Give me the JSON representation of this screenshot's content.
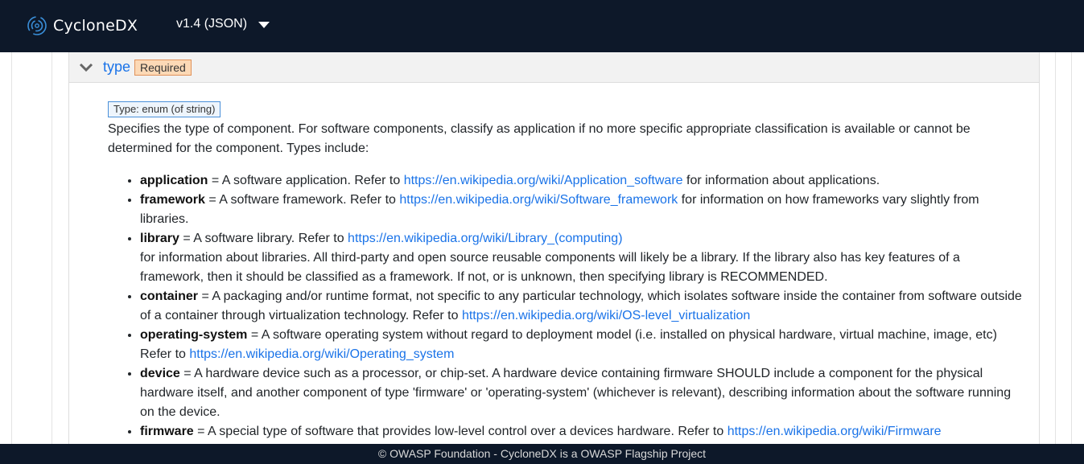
{
  "nav": {
    "brand": "CycloneDX",
    "version_label": "v1.4 (JSON)"
  },
  "property": {
    "name": "type",
    "required_badge": "Required",
    "type_badge": "Type: enum (of string)",
    "description": "Specifies the type of component. For software components, classify as application if no more specific appropriate classification is available or cannot be determined for the component. Types include:",
    "items": [
      {
        "term": "application",
        "before": " = A software application. Refer to ",
        "link": "https://en.wikipedia.org/wiki/Application_software",
        "after": " for information about applications."
      },
      {
        "term": "framework",
        "before": " = A software framework. Refer to ",
        "link": "https://en.wikipedia.org/wiki/Software_framework",
        "after": " for information on how frameworks vary slightly from libraries."
      },
      {
        "term": "library",
        "before": " = A software library. Refer to ",
        "link": "https://en.wikipedia.org/wiki/Library_(computing)",
        "after": "for information about libraries. All third-party and open source reusable components will likely be a library. If the library also has key features of a framework, then it should be classified as a framework. If not, or is unknown, then specifying library is RECOMMENDED."
      },
      {
        "term": "container",
        "before": " = A packaging and/or runtime format, not specific to any particular technology, which isolates software inside the container from software outside of a container through virtualization technology. Refer to ",
        "link": "https://en.wikipedia.org/wiki/OS-level_virtualization",
        "after": ""
      },
      {
        "term": "operating-system",
        "before": " = A software operating system without regard to deployment model (i.e. installed on physical hardware, virtual machine, image, etc) Refer to ",
        "link": "https://en.wikipedia.org/wiki/Operating_system",
        "after": ""
      },
      {
        "term": "device",
        "before": " = A hardware device such as a processor, or chip-set. A hardware device containing firmware SHOULD include a component for the physical hardware itself, and another component of type 'firmware' or 'operating-system' (whichever is relevant), describing information about the software running on the device.",
        "link": "",
        "after": ""
      },
      {
        "term": "firmware",
        "before": " = A special type of software that provides low-level control over a devices hardware. Refer to ",
        "link": "https://en.wikipedia.org/wiki/Firmware",
        "after": ""
      }
    ]
  },
  "footer": {
    "text": "© OWASP Foundation - CycloneDX is a OWASP Flagship Project"
  },
  "colors": {
    "navbar": "#0d1829",
    "link": "#1a73e8",
    "required_badge_bg": "#fcd9b6",
    "type_badge_border": "#4a90d9"
  }
}
